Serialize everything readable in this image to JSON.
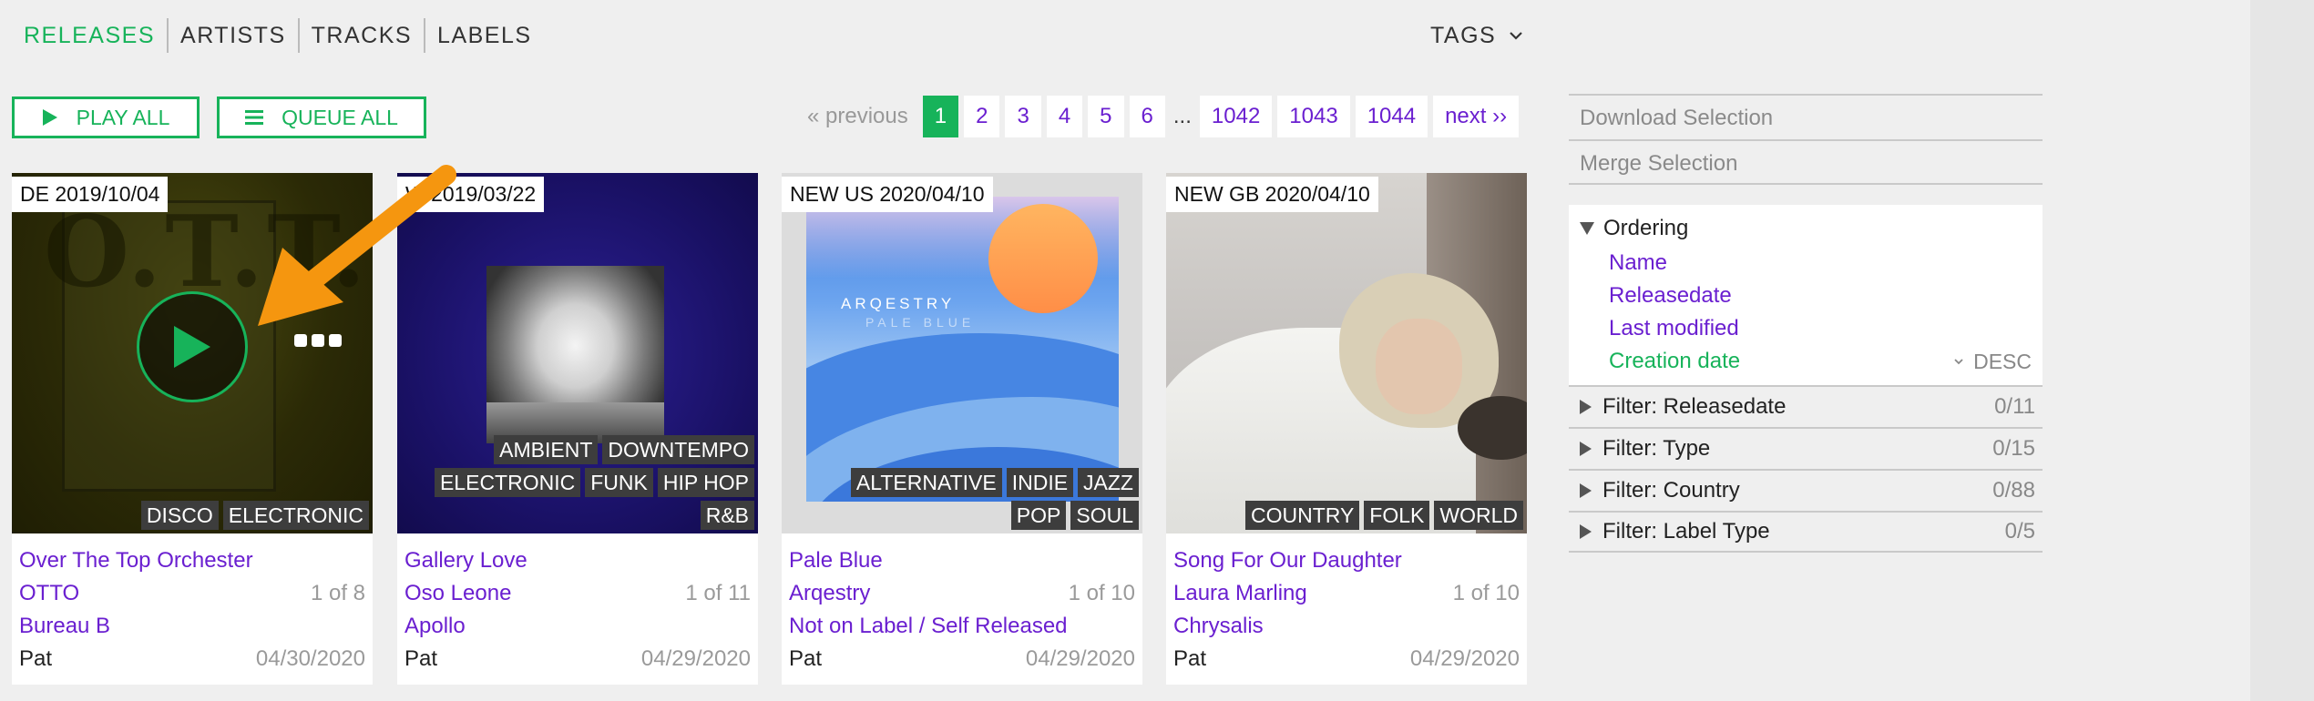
{
  "nav": {
    "items": [
      "RELEASES",
      "ARTISTS",
      "TRACKS",
      "LABELS"
    ],
    "tags_label": "TAGS"
  },
  "actions": {
    "play_all": "PLAY ALL",
    "queue_all": "QUEUE ALL"
  },
  "pagination": {
    "previous": "« previous",
    "pages": [
      "1",
      "2",
      "3",
      "4",
      "5",
      "6"
    ],
    "ellipsis": "...",
    "tail_pages": [
      "1042",
      "1043",
      "1044"
    ],
    "next": "next ››",
    "current": "1"
  },
  "releases": [
    {
      "date_badge": "DE 2019/10/04",
      "genres": [
        "DISCO",
        "ELECTRONIC"
      ],
      "title": "Over The Top Orchester",
      "artist": "OTTO",
      "position": "1 of 8",
      "label": "Bureau B",
      "user": "Pat",
      "added": "04/30/2020",
      "cover_text": "O.T.T.O."
    },
    {
      "date_badge": "W 2019/03/22",
      "genres": [
        "AMBIENT",
        "DOWNTEMPO",
        "ELECTRONIC",
        "FUNK",
        "HIP HOP",
        "R&B"
      ],
      "title": "Gallery Love",
      "artist": "Oso Leone",
      "position": "1 of 11",
      "label": "Apollo",
      "user": "Pat",
      "added": "04/29/2020"
    },
    {
      "date_badge": "NEW  US 2020/04/10",
      "genres": [
        "ALTERNATIVE",
        "INDIE",
        "JAZZ",
        "POP",
        "SOUL"
      ],
      "title": "Pale Blue",
      "artist": "Arqestry",
      "position": "1 of 10",
      "label": "Not on Label / Self Released",
      "user": "Pat",
      "added": "04/29/2020",
      "cover_text": "ARQESTRY",
      "cover_subtext": "PALE BLUE"
    },
    {
      "date_badge": "NEW  GB 2020/04/10",
      "genres": [
        "COUNTRY",
        "FOLK",
        "WORLD"
      ],
      "title": "Song For Our Daughter",
      "artist": "Laura Marling",
      "position": "1 of 10",
      "label": "Chrysalis",
      "user": "Pat",
      "added": "04/29/2020"
    }
  ],
  "panel": {
    "download_selection": "Download Selection",
    "merge_selection": "Merge Selection",
    "ordering_title": "Ordering",
    "ordering_options": [
      "Name",
      "Releasedate",
      "Last modified"
    ],
    "ordering_active": "Creation date",
    "ordering_direction": "DESC",
    "filters": [
      {
        "label": "Filter: Releasedate",
        "count": "0/11"
      },
      {
        "label": "Filter: Type",
        "count": "0/15"
      },
      {
        "label": "Filter: Country",
        "count": "0/88"
      },
      {
        "label": "Filter: Label Type",
        "count": "0/5"
      }
    ]
  },
  "colors": {
    "accent_green": "#17b35a",
    "link_purple": "#6a1fd0",
    "annotation_arrow": "#f5960f"
  }
}
